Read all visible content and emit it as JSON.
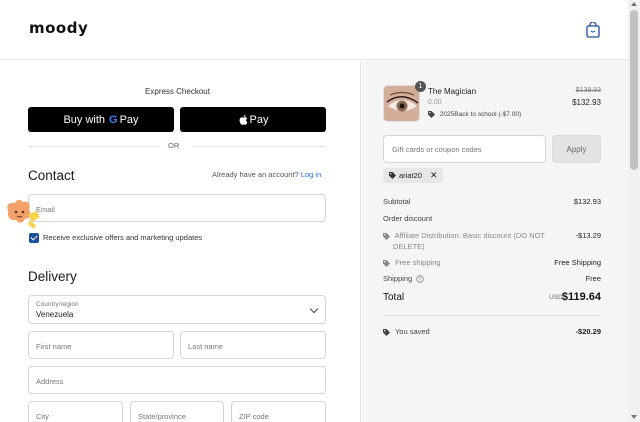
{
  "header": {
    "logo": "moody",
    "cart_icon": "shopping-bag-icon"
  },
  "express": {
    "title": "Express Checkout",
    "gpay_prefix": "Buy with",
    "gpay_brand_g": "G",
    "gpay_brand_pay": "Pay",
    "applepay_label": "Pay",
    "or": "OR"
  },
  "contact": {
    "heading": "Contact",
    "account_prompt": "Already have an account?",
    "login_link": "Log in",
    "email_placeholder": "Email",
    "marketing_label": "Receive exclusive offers and marketing updates",
    "marketing_checked": true
  },
  "delivery": {
    "heading": "Delivery",
    "country_label": "Country/region",
    "country_value": "Venezuela",
    "first_name": "First name",
    "last_name": "Last name",
    "address": "Address",
    "city": "City",
    "state": "State/province",
    "zip": "ZIP code"
  },
  "order": {
    "product_name": "The Magician",
    "product_sub": "0.00",
    "quantity": "1",
    "discount_line": "2025Back to school (-$7.00)",
    "old_price": "$139.93",
    "new_price": "$132.93",
    "gift_placeholder": "Gift cards or coupon codes",
    "apply_label": "Apply",
    "applied_code": "ariat20",
    "subtotal_label": "Subtotal",
    "subtotal_value": "$132.93",
    "order_discount_label": "Order discount",
    "affiliate_line1": "Affiliate Distribution: Basic discount (DO NOT",
    "affiliate_line2": "DELETE)",
    "affiliate_value": "-$13.29",
    "free_ship_label": "Free shipping",
    "free_ship_value": "Free Shipping",
    "shipping_label": "Shipping",
    "shipping_value": "Free",
    "total_label": "Total",
    "currency": "USD",
    "total_value": "$119.64",
    "saved_label": "You saved",
    "saved_value": "-$20.29"
  },
  "colors": {
    "accent": "#1a4f9c",
    "link": "#1a73e8",
    "button_black": "#000000",
    "summary_bg": "#f5f5f5"
  }
}
